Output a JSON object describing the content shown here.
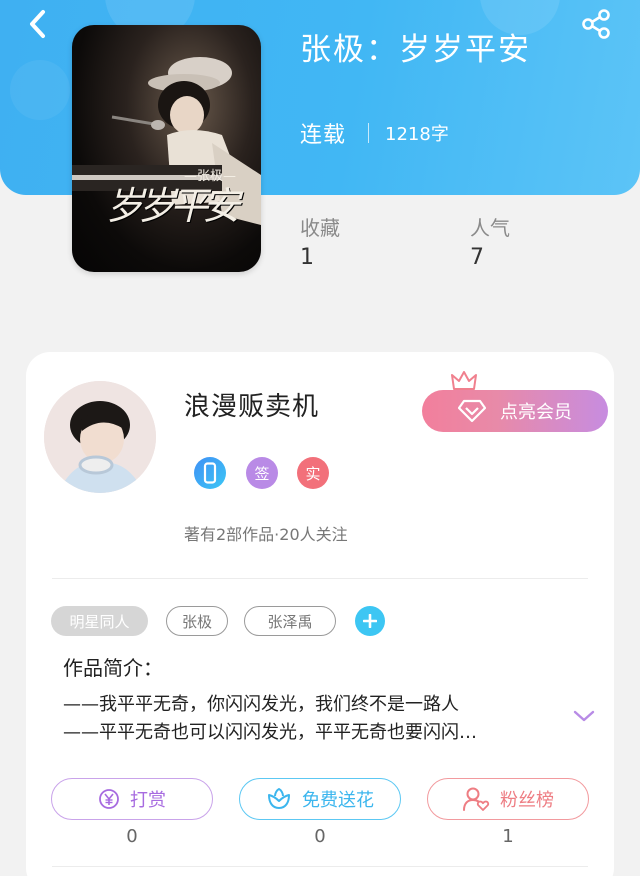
{
  "book": {
    "title": "张极：岁岁平安",
    "status": "连载",
    "word_count": "1218字",
    "stats": {
      "favorites_label": "收藏",
      "favorites_value": "1",
      "popularity_label": "人气",
      "popularity_value": "7"
    },
    "cover": {
      "script_text": "岁岁平安",
      "small_text": "—张极—"
    }
  },
  "author": {
    "name": "浪漫贩卖机",
    "vip_label": "点亮会员",
    "badges": [
      "签",
      "实"
    ],
    "works_info": "著有2部作品·20人关注"
  },
  "tags": [
    "明星同人",
    "张极",
    "张泽禹"
  ],
  "intro": {
    "title": "作品简介：",
    "lines": [
      "——我平平无奇，你闪闪发光，我们终不是一路人",
      "——平平无奇也可以闪闪发光，平平无奇也要闪闪…"
    ]
  },
  "actions": [
    {
      "label": "打赏",
      "count": "0"
    },
    {
      "label": "免费送花",
      "count": "0"
    },
    {
      "label": "粉丝榜",
      "count": "1"
    }
  ],
  "icons": {
    "back": "back-arrow-icon",
    "share": "share-icon",
    "vip": "diamond-icon",
    "crown": "crown-icon",
    "phone": "phone-icon",
    "add": "plus-icon",
    "expand": "chevron-down-icon",
    "tip": "yen-icon",
    "flower": "flower-icon",
    "fans": "user-heart-icon"
  },
  "colors": {
    "header": "#41b7f4",
    "tip": "#a76be0",
    "flower": "#3cb6ee",
    "fans": "#ee7d83"
  }
}
